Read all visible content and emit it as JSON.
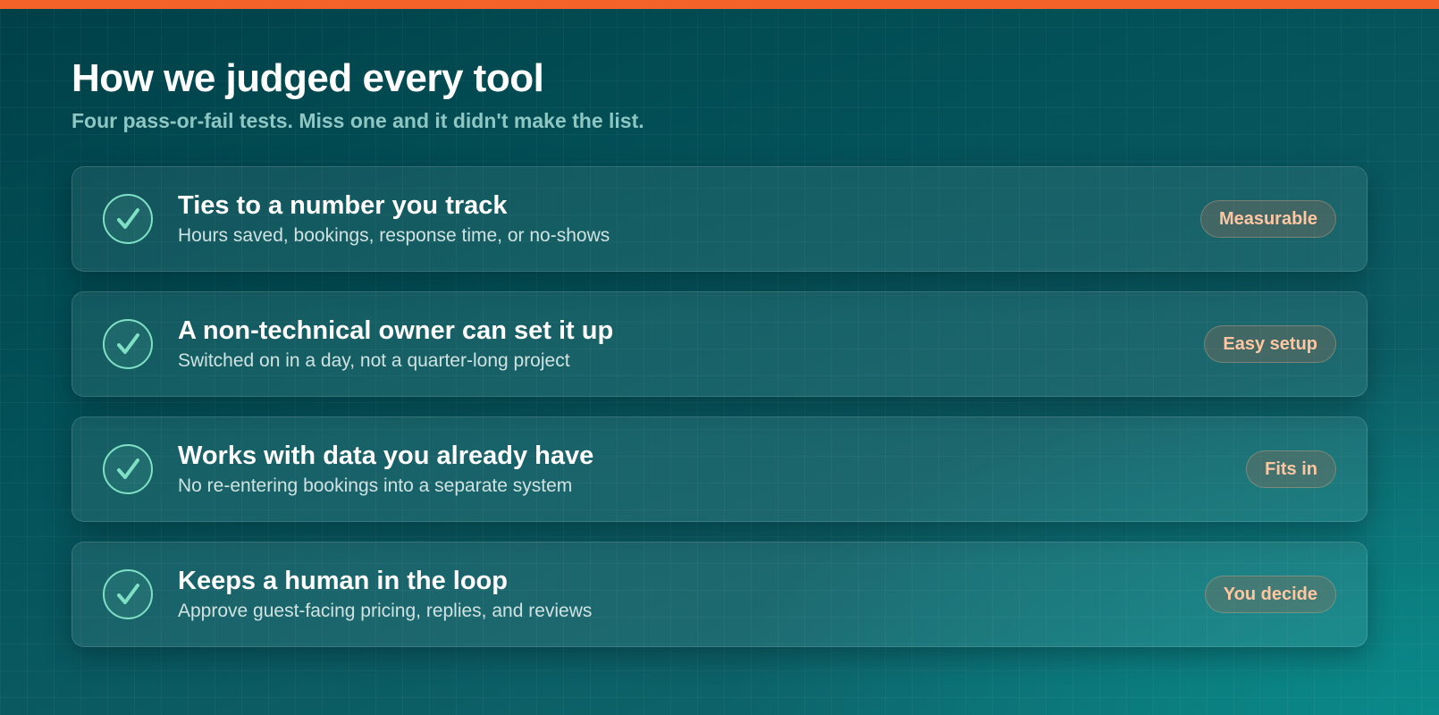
{
  "header": {
    "title": "How we judged every tool",
    "subtitle": "Four pass-or-fail tests. Miss one and it didn't make the list."
  },
  "criteria": [
    {
      "title": "Ties to a number you track",
      "description": "Hours saved, bookings, response time, or no-shows",
      "badge": "Measurable",
      "icon": "check-icon"
    },
    {
      "title": "A non-technical owner can set it up",
      "description": "Switched on in a day, not a quarter-long project",
      "badge": "Easy setup",
      "icon": "check-icon"
    },
    {
      "title": "Works with data you already have",
      "description": "No re-entering bookings into a separate system",
      "badge": "Fits in",
      "icon": "check-icon"
    },
    {
      "title": "Keeps a human in the loop",
      "description": "Approve guest-facing pricing, replies, and reviews",
      "badge": "You decide",
      "icon": "check-icon"
    }
  ],
  "colors": {
    "accent_bar": "#f4622a",
    "check": "#7fe0c5",
    "badge_text": "#ffc7a1"
  }
}
